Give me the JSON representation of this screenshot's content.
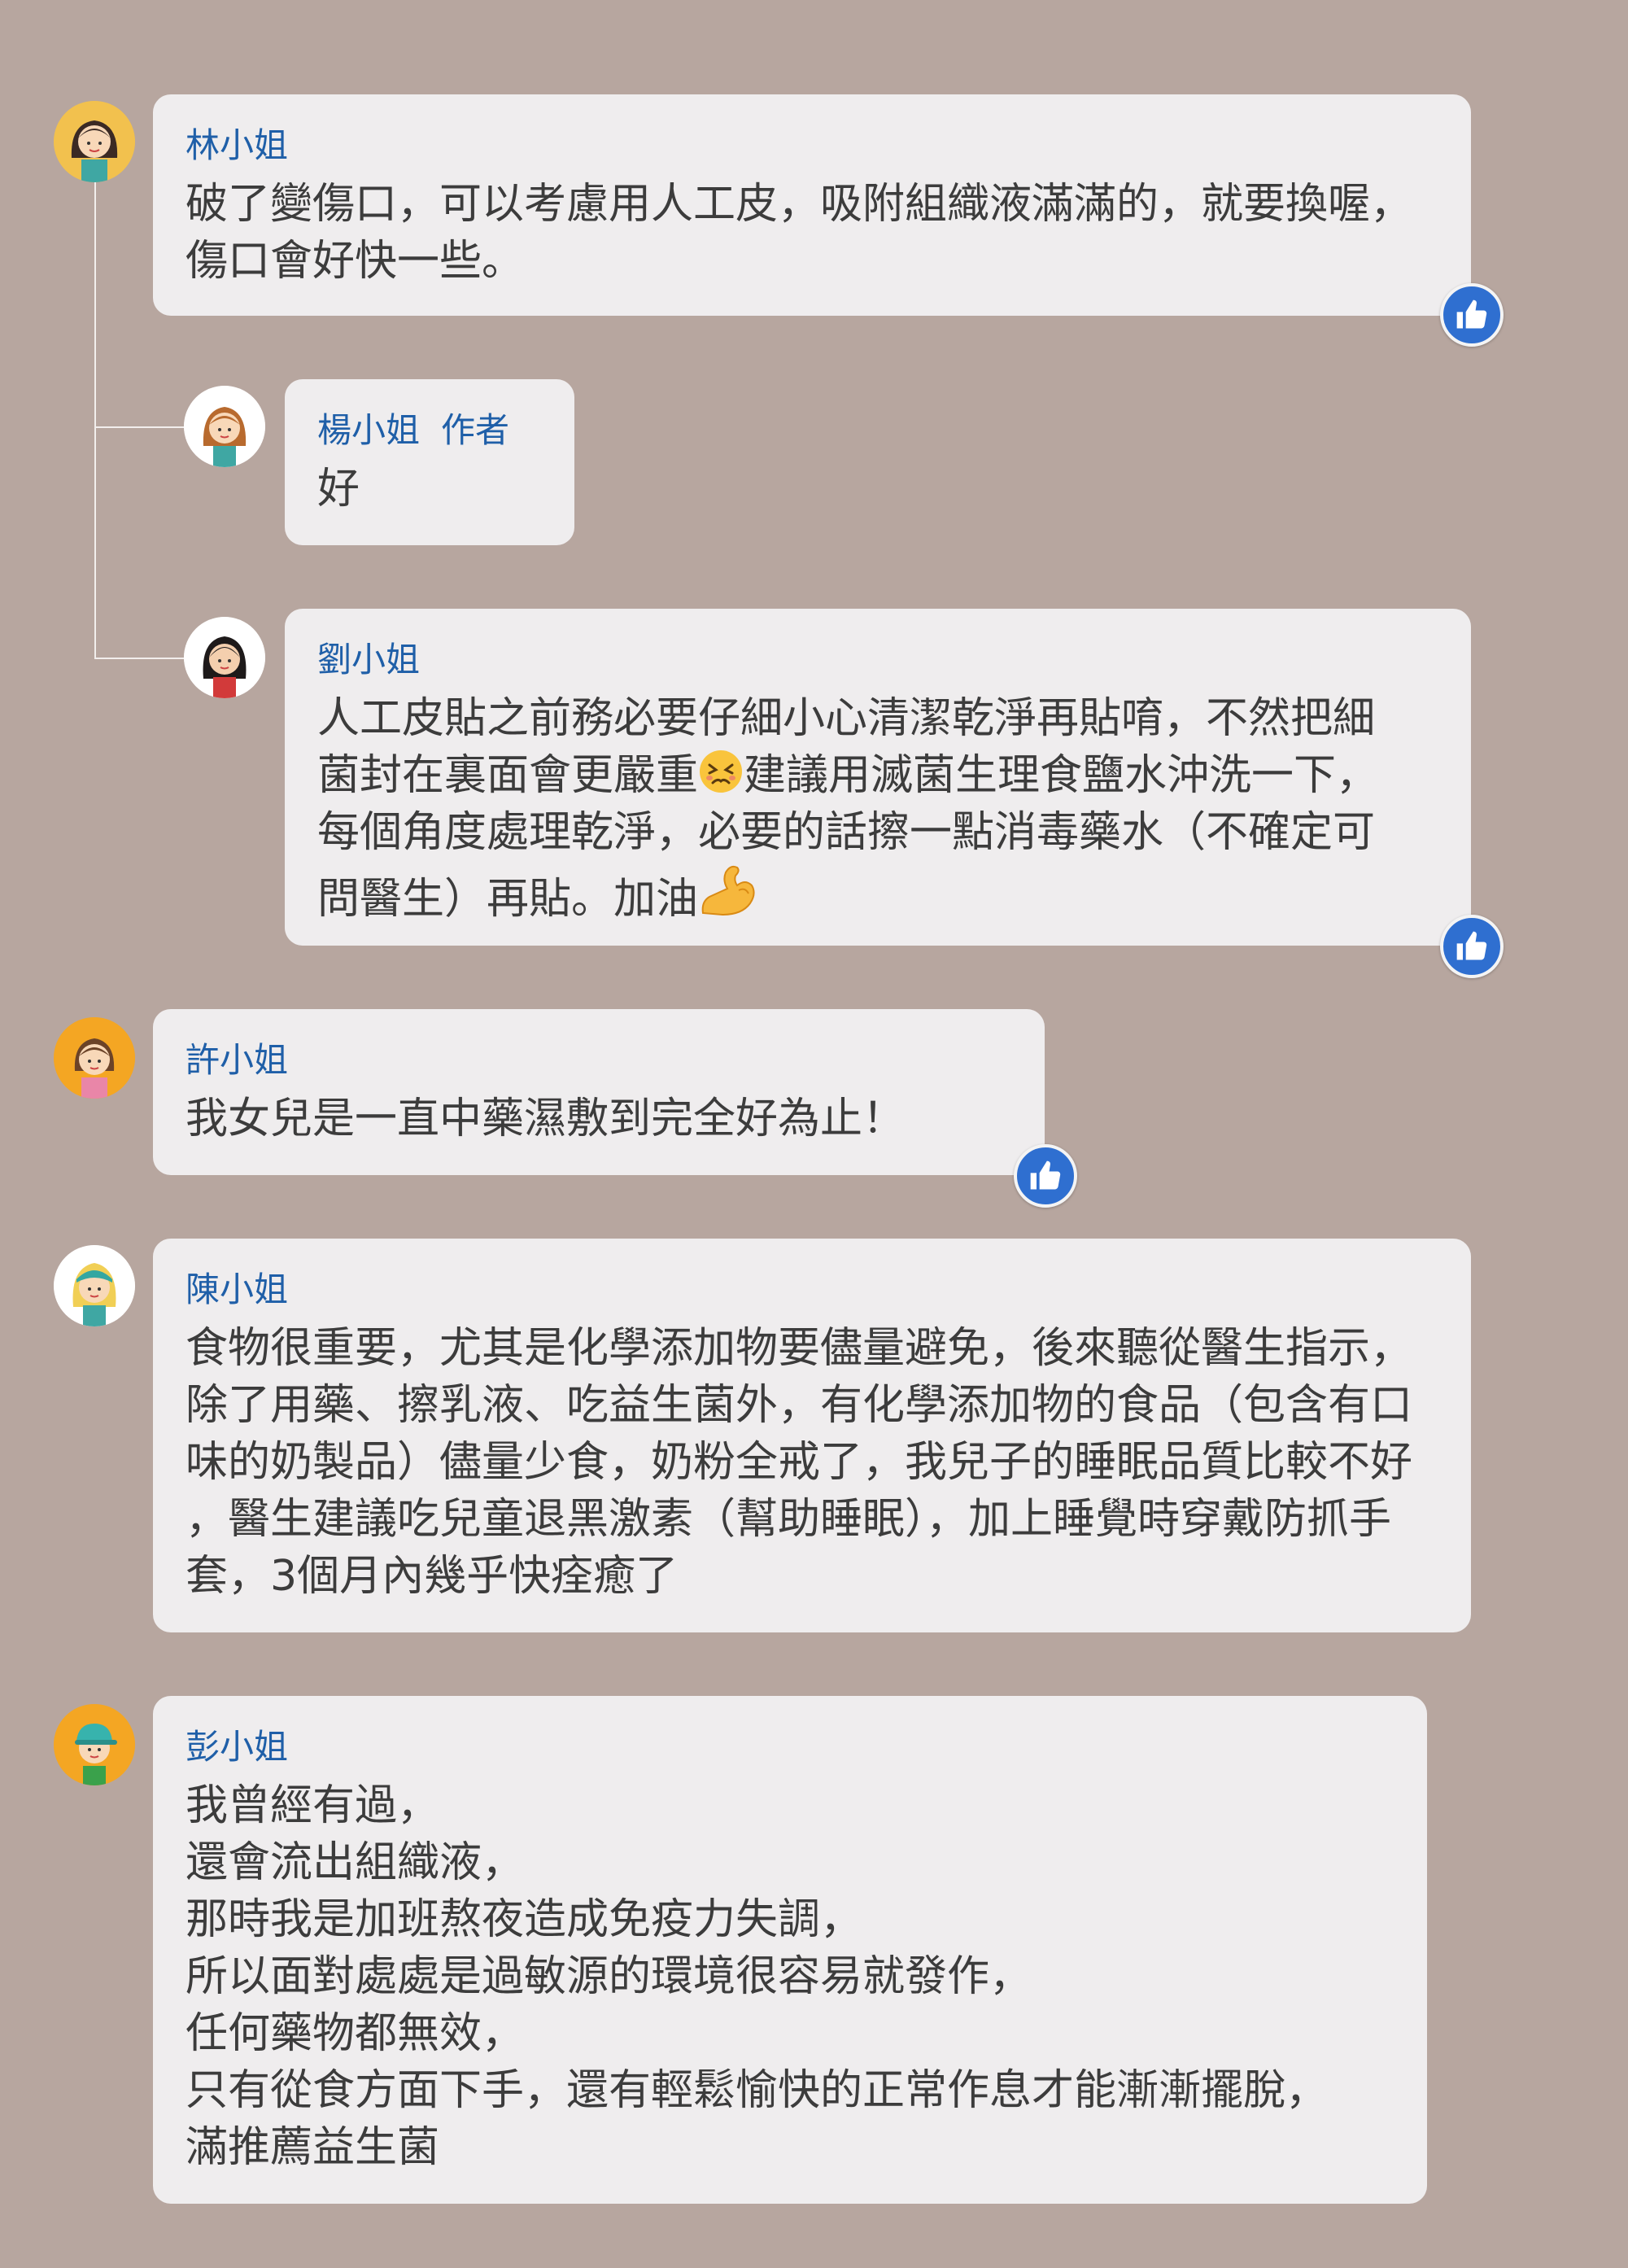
{
  "comments": [
    {
      "name": "林小姐",
      "text": "破了變傷口，可以考慮用人工皮，吸附組織液滿滿的，就要換喔，\n傷口會好快一些。"
    },
    {
      "name": "楊小姐",
      "author_tag": "作者",
      "text": "好"
    },
    {
      "name": "劉小姐",
      "text_a": "人工皮貼之前務必要仔細小心清潔乾淨再貼唷，不然把細\n菌封在裏面會更嚴重",
      "text_b": "建議用滅菌生理食鹽水沖洗一下，\n每個角度處理乾淨，必要的話擦一點消毒藥水（不確定可\n問醫生）再貼。加油"
    },
    {
      "name": "許小姐",
      "text": "我女兒是一直中藥濕敷到完全好為止！"
    },
    {
      "name": "陳小姐",
      "text": "食物很重要，尤其是化學添加物要儘量避免，後來聽從醫生指示，\n除了用藥、擦乳液、吃益生菌外，有化學添加物的食品（包含有口\n味的奶製品）儘量少食，奶粉全戒了，我兒子的睡眠品質比較不好\n，醫生建議吃兒童退黑激素（幫助睡眠），加上睡覺時穿戴防抓手\n套，3個月內幾乎快痊癒了"
    },
    {
      "name": "彭小姐",
      "text": "我曾經有過，\n還會流出組織液，\n那時我是加班熬夜造成免疫力失調，\n所以面對處處是過敏源的環境很容易就發作，\n任何藥物都無效，\n只有從食方面下手，還有輕鬆愉快的正常作息才能漸漸擺脫，\n滿推薦益生菌"
    }
  ],
  "icons": {
    "like": "thumbs-up-icon",
    "emoji_1": "persevering-face-emoji",
    "emoji_2": "flexed-biceps-emoji"
  },
  "colors": {
    "background": "#b7a69f",
    "bubble": "#efedee",
    "name": "#1f5fa8",
    "text": "#3c3c3c",
    "like": "#2f6fd0"
  }
}
